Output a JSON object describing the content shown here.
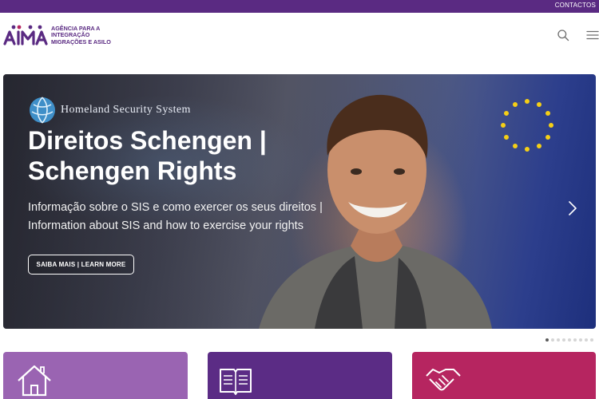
{
  "topbar": {
    "contact_label": "CONTACTOS"
  },
  "header": {
    "logo_text": "AIMA",
    "logo_tagline_lines": [
      "AGÊNCIA PARA A",
      "INTEGRAÇÃO",
      "MIGRAÇÕES E ASILO"
    ],
    "icons": [
      "search-icon",
      "hamburger-menu-icon"
    ]
  },
  "hero": {
    "brand_name": "Homeland Security System",
    "title": "Direitos Schengen | Schengen Rights",
    "description": "Informação sobre o SIS e como exercer os seus direitos | Information about SIS and how to exercise your rights",
    "cta_label": "SAIBA MAIS | LEARN MORE",
    "next_icon": "chevron-right-icon"
  },
  "carousel": {
    "slide_count": 9,
    "active_index": 0
  },
  "cards": [
    {
      "icon": "house-icon",
      "color": "#9a64b2"
    },
    {
      "icon": "open-book-icon",
      "color": "#5b2c85"
    },
    {
      "icon": "handshake-icon",
      "color": "#b62560"
    }
  ],
  "colors": {
    "brand_purple": "#5a2a82",
    "accent_dot": "#b62560"
  }
}
